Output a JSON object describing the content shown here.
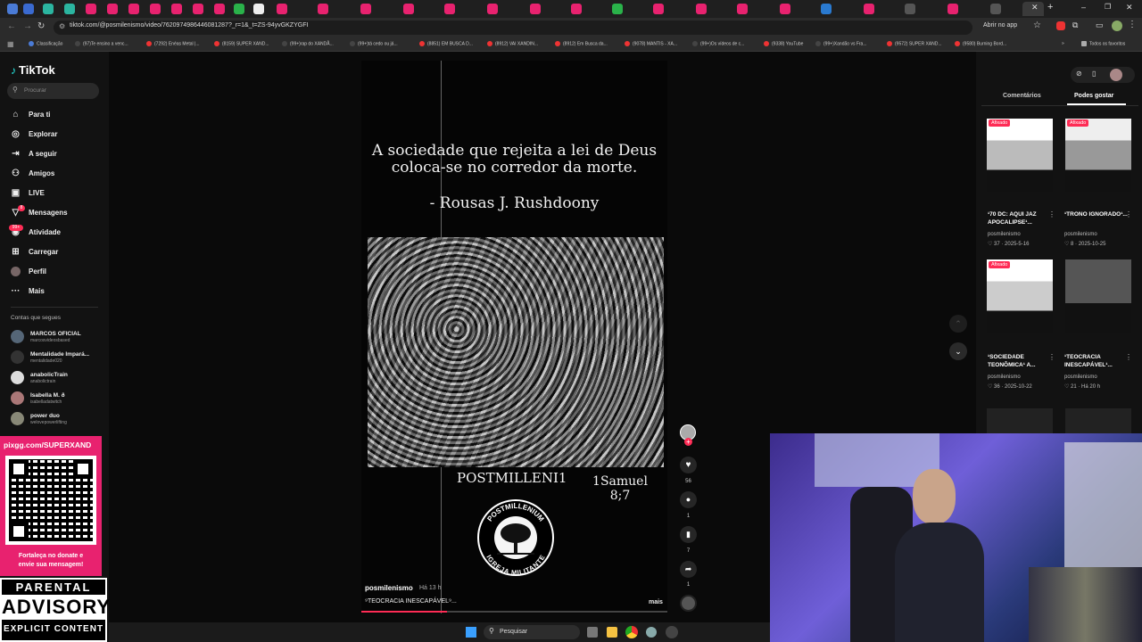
{
  "browser": {
    "url": "tiktok.com/@posmilenismo/video/7620974986446081287?_r=1&_t=ZS-94yvGKZYGFI",
    "open_in_app": "Abrir no app",
    "bookmarks": [
      "Classificação",
      "(97)Te ensino a venc...",
      "(7292) Enéas Metal |...",
      "(8159) SUPER XAND...",
      "(99+)rap do XANDÃ...",
      "(99+)tá cedo ou já...",
      "(8851) EM BUSCA D...",
      "(8912) VAI XANDIN...",
      "(8912) Em Busca da...",
      "(9078) MANTIS - XA...",
      "(99+)Os vídeos de c...",
      "(9338) YouTube",
      "(99+)Xandão vs Fra...",
      "(9572) SUPER XAND...",
      "(9580) Burning Bord..."
    ],
    "all_favorites": "Todos os favoritos"
  },
  "sidebar": {
    "logo": "TikTok",
    "search_placeholder": "Procurar",
    "nav": [
      {
        "label": "Para ti",
        "icon": "home-icon"
      },
      {
        "label": "Explorar",
        "icon": "compass-icon"
      },
      {
        "label": "A seguir",
        "icon": "following-icon"
      },
      {
        "label": "Amigos",
        "icon": "friends-icon"
      },
      {
        "label": "LIVE",
        "icon": "live-icon"
      },
      {
        "label": "Mensagens",
        "icon": "messages-icon",
        "badge": "8"
      },
      {
        "label": "Atividade",
        "icon": "activity-icon",
        "badge": "99+"
      },
      {
        "label": "Carregar",
        "icon": "upload-icon"
      },
      {
        "label": "Perfil",
        "icon": "profile-icon"
      },
      {
        "label": "Mais",
        "icon": "more-icon"
      }
    ],
    "following_title": "Contas que segues",
    "following": [
      {
        "name": "MARCOS OFICIAL",
        "handle": "marcosvideosbased"
      },
      {
        "name": "Mentalidade Impará...",
        "handle": "mentalidade020"
      },
      {
        "name": "anabolicTrain",
        "handle": "anabolictrain"
      },
      {
        "name": "Isabella M. ð",
        "handle": "isabelladatwitch"
      },
      {
        "name": "power duo",
        "handle": "welovepowerlifting"
      }
    ]
  },
  "video": {
    "quote_line1": "A sociedade que rejeita a lei de Deus",
    "quote_line2": "coloca-se no corredor da morte.",
    "author": "- Rousas J. Rushdoony",
    "caption_left": "POSTMILLENI1",
    "caption_right1": "1Samuel",
    "caption_right2": "8;7",
    "seal_top": "POSTMILLENIUM",
    "seal_bottom": "IGREJA MILITANTE",
    "username": "posmilenismo",
    "time": "Há 13 h",
    "description": "⁹TEOCRACIA INESCAPÁVEL⁹...",
    "more": "mais",
    "likes": "56",
    "comments": "1",
    "saves": "7",
    "shares": "1"
  },
  "right_panel": {
    "tabs": [
      "Comentários",
      "Podes gostar"
    ],
    "cards": [
      {
        "title": "¹70 DC: AQUI JAZ APOCALIPSE¹...",
        "author": "posmilenismo",
        "stats": "37 · 2025-5-16",
        "badge": "Afixado"
      },
      {
        "title": "¹TRONO IGNORADO¹...",
        "author": "posmilenismo",
        "stats": "8 · 2025-10-25",
        "badge": "Afixado"
      },
      {
        "title": "¹SOCIEDADE TEONÔMICA¹ A...",
        "author": "posmilenismo",
        "stats": "36 · 2025-10-22",
        "badge": "Afixado"
      },
      {
        "title": "¹TEOCRACIA INESCAPÁVEL¹...",
        "author": "posmilenismo",
        "stats": "21 · Há 20 h",
        "badge": ""
      }
    ]
  },
  "overlay": {
    "qr_url": "pixgg.com/SUPERXAND",
    "qr_text1": "Fortaleça no donate e",
    "qr_text2": "envie sua mensagem!",
    "advisory1": "PARENTAL",
    "advisory2": "ADVISORY",
    "advisory3": "EXPLICIT CONTENT"
  },
  "taskbar": {
    "search": "Pesquisar"
  }
}
